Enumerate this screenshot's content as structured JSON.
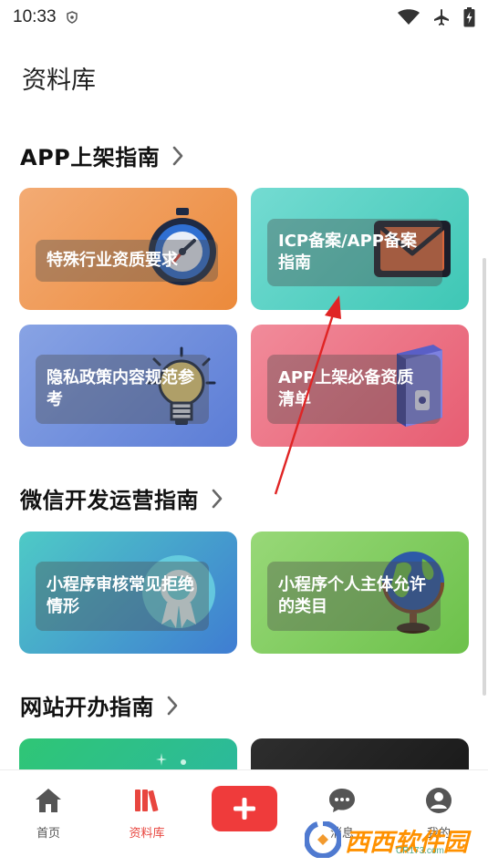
{
  "status_bar": {
    "time": "10:33"
  },
  "page": {
    "title": "资料库"
  },
  "sections": [
    {
      "title": "APP上架指南",
      "cards": [
        {
          "label": "特殊行业资质要求",
          "icon": "stopwatch-icon",
          "gradient": [
            "#f2a36b",
            "#ee8c3e"
          ]
        },
        {
          "label": "ICP备案/APP备案指南",
          "icon": "envelope-icon",
          "gradient": [
            "#6fd7cf",
            "#3dc7b6"
          ]
        },
        {
          "label": "隐私政策内容规范参考",
          "icon": "lightbulb-icon",
          "gradient": [
            "#7f9be0",
            "#5c7ed6"
          ]
        },
        {
          "label": "APP上架必备资质清单",
          "icon": "binder-icon",
          "gradient": [
            "#f08596",
            "#e85a71"
          ]
        }
      ]
    },
    {
      "title": "微信开发运营指南",
      "cards": [
        {
          "label": "小程序审核常见拒绝情形",
          "icon": "award-badge-icon",
          "gradient": [
            "#4bc7c5",
            "#3f7fd2"
          ]
        },
        {
          "label": "小程序个人主体允许的类目",
          "icon": "globe-icon",
          "gradient": [
            "#8fd56e",
            "#6fc24d"
          ]
        }
      ]
    },
    {
      "title": "网站开办指南",
      "cards": [
        {
          "label": "",
          "icon": "rocket-icon",
          "gradient": [
            "#2fc675",
            "#2bb5a9"
          ]
        },
        {
          "label": "",
          "icon": "",
          "gradient": [
            "#2b2b2b",
            "#151515"
          ]
        }
      ]
    }
  ],
  "tab_bar": {
    "tabs": [
      {
        "label": "首页",
        "icon": "home-icon"
      },
      {
        "label": "资料库",
        "icon": "books-icon",
        "active": true
      },
      {
        "label": "",
        "icon": "plus-icon"
      },
      {
        "label": "消息",
        "icon": "chat-icon"
      },
      {
        "label": "我的",
        "icon": "user-icon"
      }
    ]
  },
  "watermark": {
    "text": "西西软件园",
    "sub": "CR173.com"
  },
  "colors": {
    "accent": "#ef3b3b",
    "active_tab": "#e8463f"
  }
}
